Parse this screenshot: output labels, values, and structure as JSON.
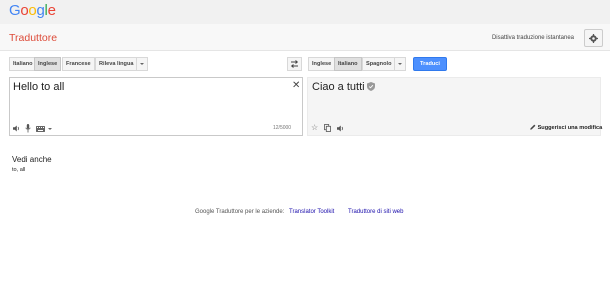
{
  "logo": {
    "letters": [
      "G",
      "o",
      "o",
      "g",
      "l",
      "e"
    ],
    "colors": [
      "#4285f4",
      "#ea4335",
      "#fbbc05",
      "#4285f4",
      "#34a853",
      "#ea4335"
    ]
  },
  "header": {
    "app_title": "Traduttore",
    "disable_instant": "Disattiva traduzione istantanea"
  },
  "source_langs": {
    "items": [
      "Italiano",
      "Inglese",
      "Francese",
      "Rileva lingua"
    ],
    "active": "Inglese"
  },
  "target_langs": {
    "items": [
      "Inglese",
      "Italiano",
      "Spagnolo"
    ],
    "active": "Italiano"
  },
  "translate_button": "Traduci",
  "source": {
    "text": "Hello to all",
    "char_count": "12/5000"
  },
  "target": {
    "text": "Ciao a tutti",
    "suggest_edit": "Suggerisci una modifica"
  },
  "see_also": {
    "title": "Vedi anche",
    "words": "to, all"
  },
  "footer": {
    "business_label": "Google Traduttore per le aziende:",
    "toolkit_link": "Translator Toolkit",
    "website_link": "Traduttore di siti web"
  },
  "colors": {
    "accent_red": "#dd4b39",
    "button_blue": "#4d90fe",
    "link_blue": "#1a0dab"
  }
}
